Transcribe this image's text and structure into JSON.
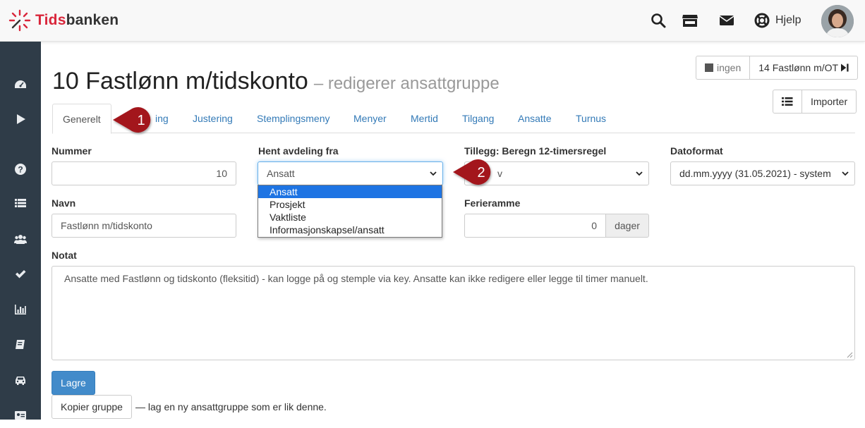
{
  "header": {
    "logo_text_red": "Tids",
    "logo_text_dark": "banken",
    "help_label": "Hjelp"
  },
  "page": {
    "title": "10 Fastlønn m/tidskonto",
    "subtitle": "– redigerer ansattgruppe"
  },
  "nav": {
    "prev_label": "ingen",
    "next_label": "14 Fastlønn m/OT"
  },
  "import_label": "Importer",
  "tabs": [
    {
      "label": "Generelt"
    },
    {
      "label": "ing"
    },
    {
      "label": "Justering"
    },
    {
      "label": "Stemplingsmeny"
    },
    {
      "label": "Menyer"
    },
    {
      "label": "Mertid"
    },
    {
      "label": "Tilgang"
    },
    {
      "label": "Ansatte"
    },
    {
      "label": "Turnus"
    }
  ],
  "form": {
    "nummer_label": "Nummer",
    "nummer_value": "10",
    "avdeling_label": "Hent avdeling fra",
    "avdeling_value": "Ansatt",
    "avdeling_options": [
      "Ansatt",
      "Prosjekt",
      "Vaktliste",
      "Informasjonskapsel/ansatt"
    ],
    "tillegg_label": "Tillegg: Beregn 12-timersregel",
    "tillegg_value": "v",
    "datoformat_label": "Datoformat",
    "datoformat_value": "dd.mm.yyyy (31.05.2021) - system",
    "navn_label": "Navn",
    "navn_value": "Fastlønn m/tidskonto",
    "ferieramme_label": "Ferieramme",
    "ferieramme_value": "0",
    "ferieramme_unit": "dager",
    "notat_label": "Notat",
    "notat_value": "Ansatte med Fastlønn og tidskonto (fleksitid) - kan logge på og stemple via key. Ansatte kan ikke redigere eller legge til timer manuelt."
  },
  "actions": {
    "save_label": "Lagre",
    "copy_label": "Kopier gruppe",
    "copy_note": "— lag en ny ansattgruppe som er lik denne."
  },
  "callouts": [
    "1",
    "2"
  ],
  "colors": {
    "brand_red": "#d9263b",
    "sidebar_bg": "#2f3c48",
    "primary_blue": "#428bca",
    "link_blue": "#337ab7",
    "callout_red": "#a3191f"
  }
}
